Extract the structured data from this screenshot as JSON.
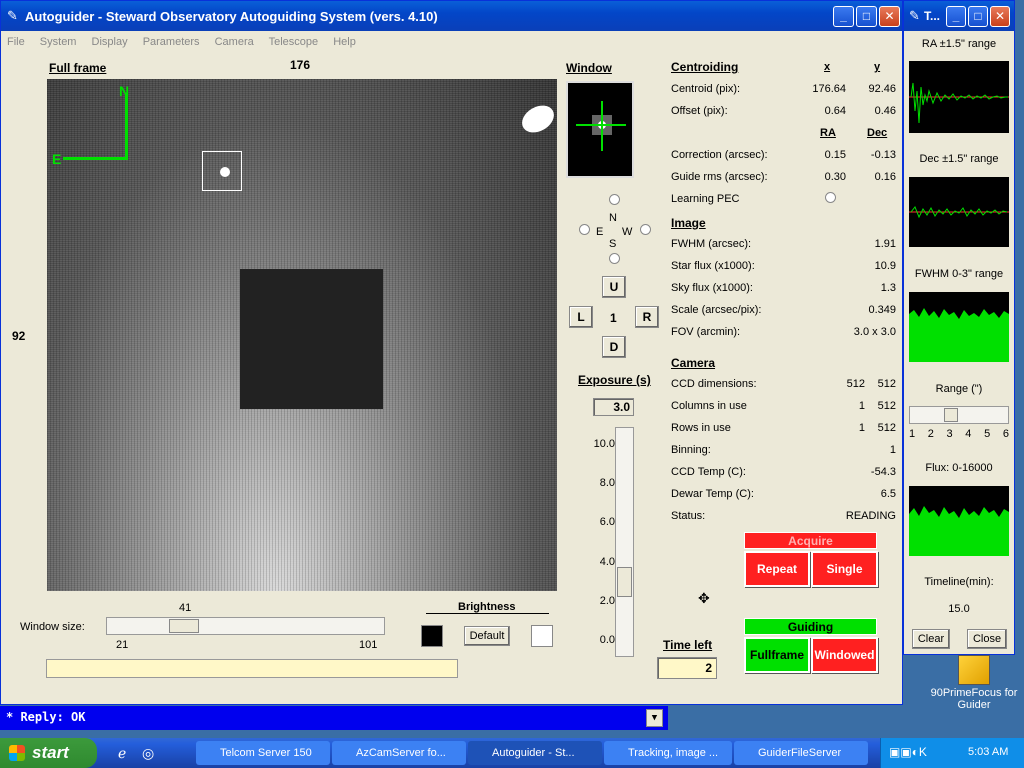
{
  "main_window": {
    "title": "Autoguider - Steward Observatory Autoguiding System (vers. 4.10)",
    "menu": [
      "File",
      "System",
      "Display",
      "Parameters",
      "Camera",
      "Telescope",
      "Help"
    ]
  },
  "full_frame": {
    "label": "Full frame",
    "x_coord": "176",
    "y_coord": "92",
    "compass_n": "N",
    "compass_e": "E"
  },
  "window_size": {
    "label": "Window size:",
    "value": "41",
    "min": "21",
    "max": "101",
    "fraction": 0.25
  },
  "brightness": {
    "label": "Brightness",
    "default_button": "Default"
  },
  "window_panel": {
    "label": "Window",
    "dir_n": "N",
    "dir_s": "S",
    "dir_e": "E",
    "dir_w": "W",
    "btn_u": "U",
    "btn_l": "L",
    "btn_r": "R",
    "btn_d": "D",
    "step": "1"
  },
  "exposure": {
    "label": "Exposure (s)",
    "value": "3.0",
    "scale": [
      "10.0",
      "8.0",
      "6.0",
      "4.0",
      "2.0",
      "0.0"
    ],
    "fraction": 0.3
  },
  "time_left": {
    "label": "Time left",
    "value": "2"
  },
  "centroiding": {
    "header": "Centroiding",
    "col_x": "x",
    "col_y": "y",
    "centroid_label": "Centroid (pix):",
    "centroid_x": "176.64",
    "centroid_y": "92.46",
    "offset_label": "Offset (pix):",
    "offset_x": "0.64",
    "offset_y": "0.46",
    "col_ra": "RA",
    "col_dec": "Dec",
    "correction_label": "Correction (arcsec):",
    "correction_ra": "0.15",
    "correction_dec": "-0.13",
    "rms_label": "Guide rms (arcsec):",
    "rms_ra": "0.30",
    "rms_dec": "0.16",
    "pec_label": "Learning PEC"
  },
  "image": {
    "header": "Image",
    "fwhm_label": "FWHM (arcsec):",
    "fwhm": "1.91",
    "star_label": "Star flux (x1000):",
    "star": "10.9",
    "sky_label": "Sky flux (x1000):",
    "sky": "1.3",
    "scale_label": "Scale (arcsec/pix):",
    "scale": "0.349",
    "fov_label": "FOV (arcmin):",
    "fov": "3.0 x 3.0"
  },
  "camera": {
    "header": "Camera",
    "dims_label": "CCD dimensions:",
    "dims_a": "512",
    "dims_b": "512",
    "cols_label": "Columns in use",
    "cols_a": "1",
    "cols_b": "512",
    "rows_label": "Rows in use",
    "rows_a": "1",
    "rows_b": "512",
    "bin_label": "Binning:",
    "bin": "1",
    "ccdtemp_label": "CCD Temp (C):",
    "ccdtemp": "-54.3",
    "dewar_label": "Dewar Temp (C):",
    "dewar": "6.5",
    "status_label": "Status:",
    "status": "READING"
  },
  "acquire": {
    "header": "Acquire",
    "repeat": "Repeat",
    "single": "Single"
  },
  "guiding": {
    "header": "Guiding",
    "fullframe": "Fullframe",
    "windowed": "Windowed"
  },
  "side_window": {
    "title": "T...",
    "ra_range": "RA ±1.5\" range",
    "dec_range": "Dec ±1.5\" range",
    "fwhm_range": "FWHM 0-3\" range",
    "range_label": "Range (\")",
    "range_ticks": [
      "1",
      "2",
      "3",
      "4",
      "5",
      "6"
    ],
    "range_fraction": 0.4,
    "flux_label": "Flux: 0-16000",
    "timeline_label": "Timeline(min):",
    "timeline_value": "15.0",
    "clear": "Clear",
    "close": "Close"
  },
  "console": {
    "text": "* Reply: OK"
  },
  "desktop_icon": {
    "label": "90PrimeFocus for Guider"
  },
  "taskbar": {
    "start": "start",
    "tasks": [
      "Telcom Server 150",
      "AzCamServer fo...",
      "Autoguider - St...",
      "Tracking, image ...",
      "GuiderFileServer"
    ],
    "clock": "5:03 AM"
  },
  "colors": {
    "plot_green": "#00e000",
    "plot_red": "#ff3030",
    "accent_red": "#ff2020"
  }
}
